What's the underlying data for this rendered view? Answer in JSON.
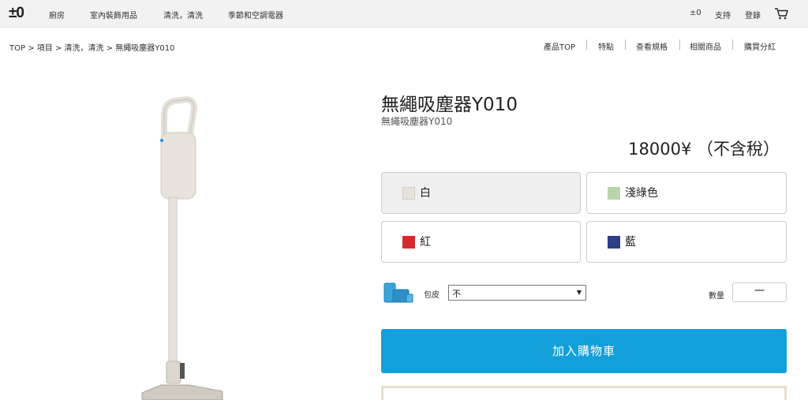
{
  "header": {
    "logo": "±0",
    "nav": [
      "廚房",
      "室內裝飾用品",
      "清洗，清洗",
      "季節和空調電器"
    ],
    "right": [
      "±0",
      "支持",
      "登錄"
    ]
  },
  "breadcrumb": "TOP > 項目 > 清洗，清洗 > 無繩吸塵器Y010",
  "subnav": [
    "產品TOP",
    "特點",
    "查看規格",
    "相關商品",
    "購買分紅"
  ],
  "product": {
    "title": "無繩吸塵器Y010",
    "subtitle": "無繩吸塵器Y010",
    "price": "18000¥ （不含稅）",
    "colors": [
      {
        "label": "白",
        "swatch": "#e6e2dc",
        "selected": true
      },
      {
        "label": "淺綠色",
        "swatch": "#b9d4a8",
        "selected": false
      },
      {
        "label": "紅",
        "swatch": "#d42c2c",
        "selected": false
      },
      {
        "label": "藍",
        "swatch": "#2d3f86",
        "selected": false
      }
    ],
    "pouch_label": "包皮",
    "pouch_value": "不",
    "qty_label": "數量",
    "qty_value": "一",
    "add_to_cart": "加入購物車"
  },
  "colors": {
    "accent": "#139fd9"
  }
}
